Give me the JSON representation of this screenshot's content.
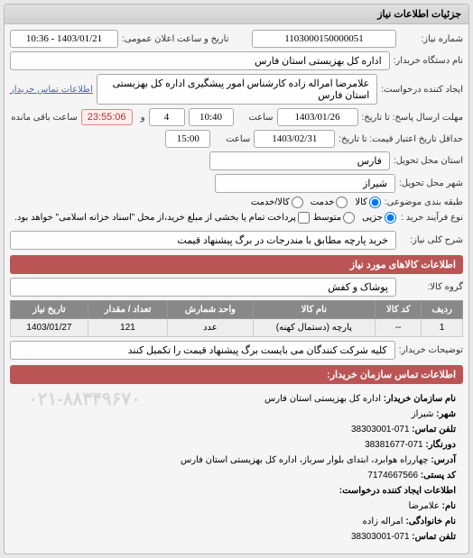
{
  "panel_title": "جزئیات اطلاعات نیاز",
  "labels": {
    "need_no": "شماره نیاز:",
    "announce_dt": "تاریخ و ساعت اعلان عمومی:",
    "buyer_org": "نام دستگاه خریدار:",
    "req_creator": "ایجاد کننده درخواست:",
    "contact_link": "اطلاعات تماس خریدار",
    "reply_deadline": "مهلت ارسال پاسخ: تا تاریخ:",
    "price_validity": "حداقل تاریخ اعتبار قیمت: تا تاریخ:",
    "saat": "ساعت",
    "va": "و",
    "remaining": "ساعت باقی مانده",
    "delivery_state": "استان محل تحویل:",
    "delivery_city": "شهر محل تحویل:",
    "class_topic": "طبقه بندی موضوعی:",
    "purchase_type": "نوع فرآیند خرید :",
    "purchase_note": "پرداخت تمام یا بخشی از مبلغ خرید،از محل \"اسناد خزانه اسلامی\" خواهد بود.",
    "overall_desc": "شرح کلی نیاز:"
  },
  "values": {
    "need_no": "1103000150000051",
    "announce_dt": "1403/01/21 - 10:36",
    "buyer_org": "اداره کل بهزیستی استان فارس",
    "req_creator": "علامرضا امراله زاده کارشناس امور پیشگیری اداره کل بهزیستی استان فارس",
    "reply_date": "1403/01/26",
    "reply_time": "10:40",
    "reply_days": "4",
    "countdown": "23:55:06",
    "price_date": "1403/02/31",
    "price_time": "15:00",
    "delivery_state": "فارس",
    "delivery_city": "شیراز",
    "overall_desc": "خرید پارچه مطابق با مندرجات در برگ پیشنهاد قیمت"
  },
  "class_options": {
    "goods": "کالا",
    "service": "خدمت",
    "goods_service": "کالا/خدمت"
  },
  "purchase_options": {
    "partial": "جزیی",
    "medium": "متوسط"
  },
  "goods_section": {
    "title": "اطلاعات کالاهای مورد نیاز",
    "group_label": "گروه کالا:",
    "group_value": "پوشاک و کفش",
    "headers": {
      "row": "ردیف",
      "code": "کد کالا",
      "name": "نام کالا",
      "unit": "واحد شمارش",
      "qty": "تعداد / مقدار",
      "date": "تاریخ نیاز"
    },
    "rows": [
      {
        "row": "1",
        "code": "--",
        "name": "پارچه (دستمال کهنه)",
        "unit": "عدد",
        "qty": "121",
        "date": "1403/01/27"
      }
    ],
    "buyer_note_label": "توضیحات خریدار:",
    "buyer_note_value": "کلیه شرکت کنندگان می بایست برگ پیشنهاد قیمت را تکمیل کنند"
  },
  "contact_section": {
    "title": "اطلاعات تماس سازمان خریدار:",
    "org_label": "نام سازمان خریدار:",
    "org": "اداره کل بهزیستی استان فارس",
    "city_label": "شهر:",
    "city": "شیراز",
    "phone_label": "تلفن تماس:",
    "phone": "071-38303001",
    "fax_label": "دورنگار:",
    "fax": "071-38381677",
    "addr_label": "آدرس:",
    "addr": "چهارراه هوابرد، ابتدای بلوار سرباز، اداره کل بهزیستی استان فارس",
    "post_label": "کد پستی:",
    "post": "7174667566",
    "creator_title": "اطلاعات ایجاد کننده درخواست:",
    "fname_label": "نام:",
    "fname": "علامرضا",
    "lname_label": "نام خانوادگی:",
    "lname": "امراله زاده",
    "cphone_label": "تلفن تماس:",
    "cphone": "071-38303001",
    "watermark": "۰۲۱-۸۸۳۴۹۶۷۰"
  }
}
